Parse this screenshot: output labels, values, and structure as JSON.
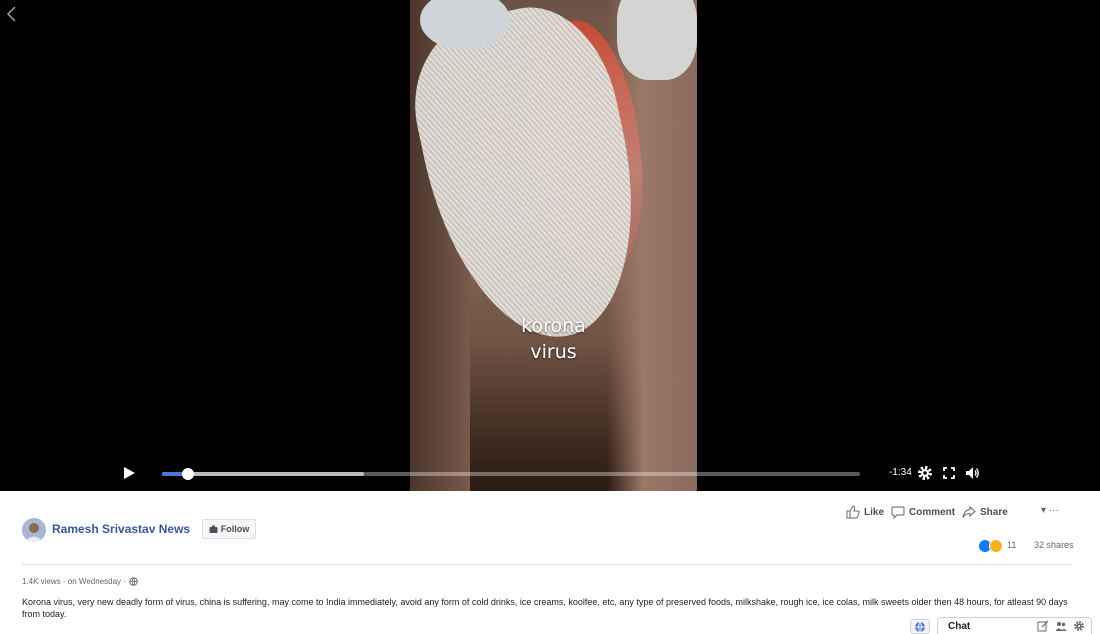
{
  "video": {
    "caption_line1": "korona",
    "caption_line2": "virus",
    "time_remaining": "-1:34",
    "progress": 0.037,
    "buffered": 0.29
  },
  "post": {
    "page_name": "Ramesh Srivastav News",
    "follow_label": "Follow",
    "actions": {
      "like": "Like",
      "comment": "Comment",
      "share": "Share",
      "more": "▾ ···"
    },
    "reaction_count": "11",
    "shares": "32 shares",
    "meta": "1.4K views · on Wednesday ·",
    "description": "Korona virus, very new deadly form of virus, china is suffering, may come to India immediately, avoid any form of cold drinks, ice creams, koolfee, etc, any type of preserved foods, milkshake, rough ice, ice colas, milk sweets older then 48 hours, for atleast 90 days from today."
  },
  "chat": {
    "label": "Chat"
  },
  "colors": {
    "link": "#365899",
    "progress": "#4a76d6",
    "like_blue": "#1877f2",
    "wow_yellow": "#f7b125"
  },
  "icons": [
    "back-arrow-icon",
    "play-icon",
    "settings-gear-icon",
    "fullscreen-icon",
    "volume-icon",
    "thumbs-up-icon",
    "comment-icon",
    "share-arrow-icon",
    "globe-icon",
    "compose-icon",
    "people-icon",
    "gear-icon"
  ]
}
